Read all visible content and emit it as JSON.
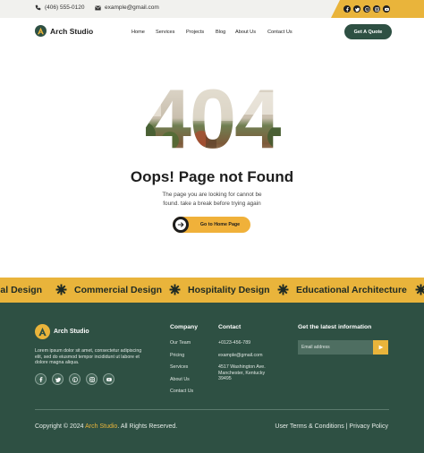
{
  "topbar": {
    "phone": "(406) 555-0120",
    "email": "example@gmail.com",
    "social_icons": [
      "facebook-icon",
      "twitter-icon",
      "pinterest-icon",
      "instagram-icon",
      "youtube-icon"
    ]
  },
  "header": {
    "logo_text": "Arch Studio",
    "nav": [
      "Home",
      "Services",
      "Projects",
      "Blog",
      "About Us",
      "Contact Us"
    ],
    "cta_label": "Get A Quote"
  },
  "hero": {
    "code": "404",
    "title": "Oops! Page not Found",
    "description_line1": "The page you are looking for cannot be",
    "description_line2": "found. take a break before trying again",
    "button_label": "Go to Home Page"
  },
  "marquee": {
    "items": [
      "tial Design",
      "Commercial Design",
      "Hospitality Design",
      "Educational Architecture"
    ]
  },
  "footer": {
    "logo_text": "Arch Studio",
    "about": "Lorem ipsum dolor sit amet, consectetur adipiscing elit, sed do eiusmod tempor incididunt ut labore et dolore magna aliqua.",
    "company_heading": "Company",
    "company_links": [
      "Our Team",
      "Pricing",
      "Services",
      "About Us",
      "Contact Us"
    ],
    "contact_heading": "Contact",
    "contact_phone": "+0123-456-789",
    "contact_email": "example@gmail.com",
    "contact_address_line1": "4517 Washington Ave.",
    "contact_address_line2": "Manchester, Kentucky",
    "contact_address_line3": "39495",
    "newsletter_heading": "Get the latest information",
    "email_placeholder": "Email address",
    "copyright_prefix": "Copyright © 2024 ",
    "copyright_brand": "Arch Studio",
    "copyright_suffix": ". All Rights Reserved.",
    "legal_terms": "User Terms & Conditions",
    "legal_separator": " | ",
    "legal_privacy": "Privacy Policy"
  },
  "colors": {
    "accent": "#e9b43b",
    "brand_green": "#2e5043"
  }
}
